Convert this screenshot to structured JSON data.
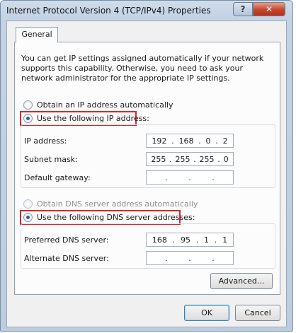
{
  "window": {
    "title": "Internet Protocol Version 4 (TCP/IPv4) Properties",
    "help_label": "?",
    "close_label": "✕"
  },
  "tabs": [
    {
      "label": "General",
      "active": true
    }
  ],
  "description": "You can get IP settings assigned automatically if your network supports this capability. Otherwise, you need to ask your network administrator for the appropriate IP settings.",
  "ip": {
    "auto_label": "Obtain an IP address automatically",
    "manual_label": "Use the following IP address:",
    "selected": "manual",
    "fields": [
      {
        "label": "IP address:",
        "octets": [
          "192",
          "168",
          "0",
          "2"
        ]
      },
      {
        "label": "Subnet mask:",
        "octets": [
          "255",
          "255",
          "255",
          "0"
        ]
      },
      {
        "label": "Default gateway:",
        "octets": [
          "",
          "",
          "",
          ""
        ]
      }
    ]
  },
  "dns": {
    "auto_label": "Obtain DNS server address automatically",
    "manual_label": "Use the following DNS server addresses:",
    "selected": "manual",
    "fields": [
      {
        "label": "Preferred DNS server:",
        "octets": [
          "168",
          "95",
          "1",
          "1"
        ]
      },
      {
        "label": "Alternate DNS server:",
        "octets": [
          "",
          "",
          "",
          ""
        ]
      }
    ]
  },
  "buttons": {
    "advanced": "Advanced...",
    "ok": "OK",
    "cancel": "Cancel"
  },
  "colors": {
    "highlight": "#d9262b",
    "radio_selected": "#2a5cb6",
    "close_button": "#c7452a"
  }
}
